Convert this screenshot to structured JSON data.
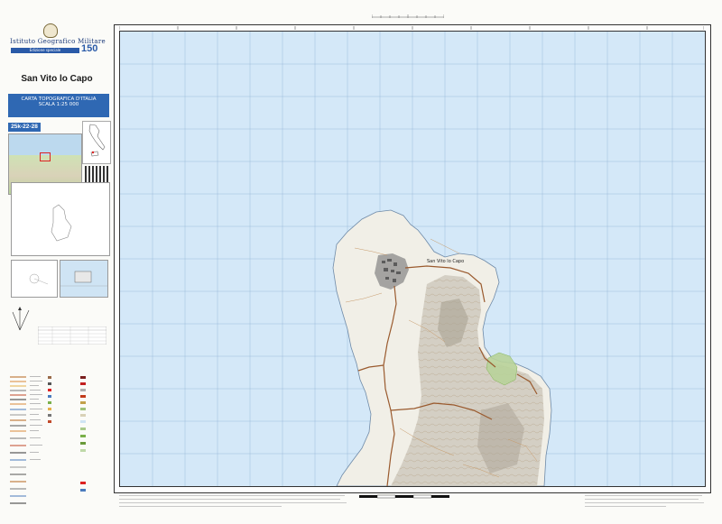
{
  "header": {
    "institute_name": "Istituto Geografico Militare",
    "edition": "Edizione speciale"
  },
  "sheet": {
    "name": "San Vito lo Capo",
    "series_title": "CARTA TOPOGRAFICA D'ITALIA",
    "scale": "SCALA 1:25 000",
    "code": "25k-22-28"
  },
  "map": {
    "town_label": "San Vito lo Capo"
  },
  "colors": {
    "sea": "#d4e8f8",
    "land": "#f1efe7",
    "road": "#9a5a2e",
    "relief": "#c9c4b8",
    "accent_blue": "#2f68b3",
    "grid": "#8fb3d4"
  },
  "icons": [
    "emblem-icon",
    "north-arrow-icon",
    "qr-code-icon"
  ]
}
